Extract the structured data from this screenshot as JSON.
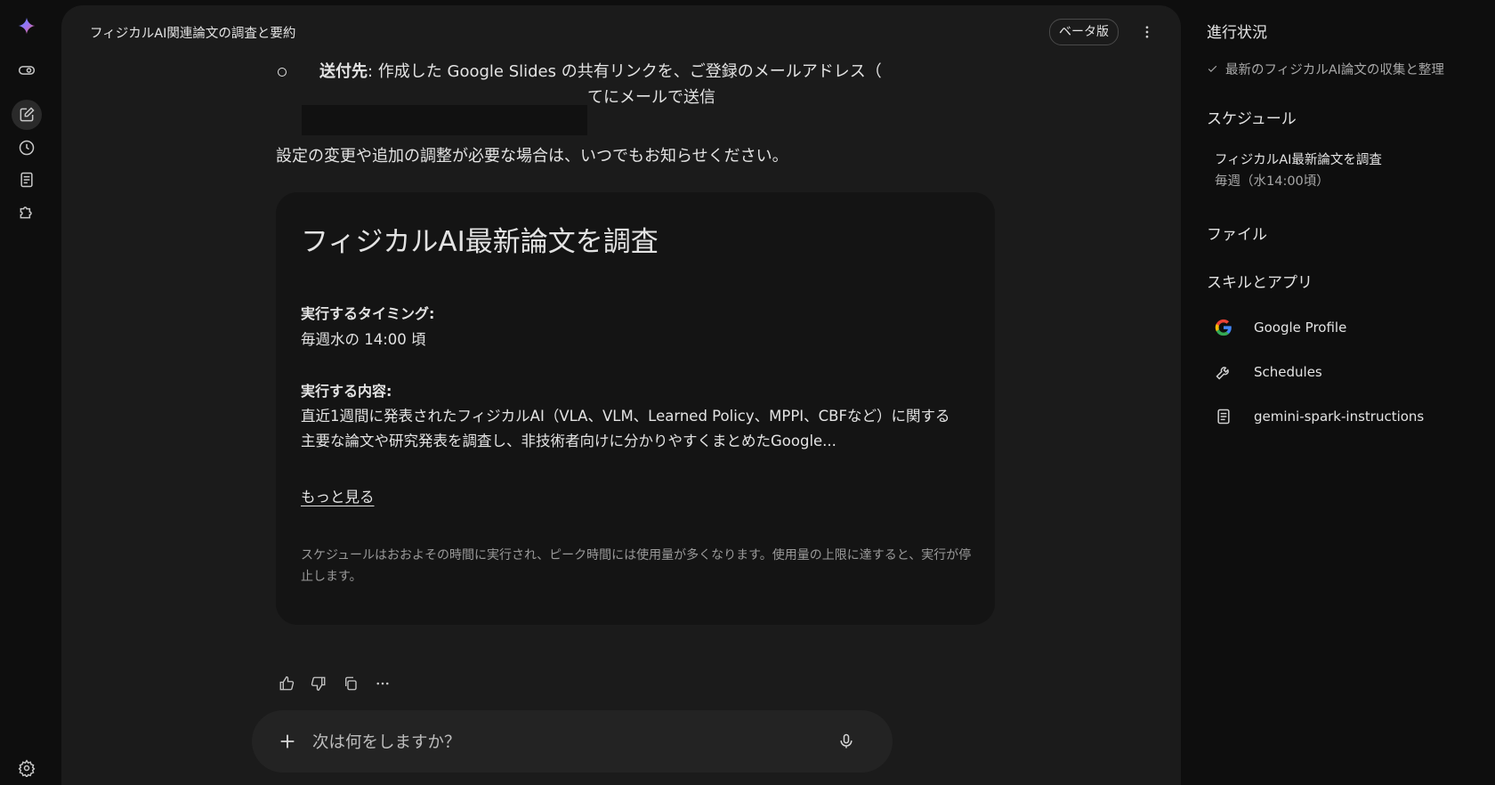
{
  "header": {
    "title": "フィジカルAI関連論文の調査と要約",
    "beta_label": "ベータ版"
  },
  "message": {
    "bullet_bold": "送付先",
    "bullet_text": ": 作成した Google Slides の共有リンクを、ご登録のメールアドレス（",
    "bullet_text_tail": "てにメールで送信",
    "paragraph": "設定の変更や追加の調整が必要な場合は、いつでもお知らせください。"
  },
  "card": {
    "title": "フィジカルAI最新論文を調査",
    "timing_label": "実行するタイミング:",
    "timing_value": "毎週水の 14:00 頃",
    "content_label": "実行する内容:",
    "content_line1": "直近1週間に発表されたフィジカルAI（VLA、VLM、Learned Policy、MPPI、CBFなど）に関する",
    "content_line2": "主要な論文や研究発表を調査し、非技術者向けに分かりやすくまとめたGoogle...",
    "more_link": "もっと見る",
    "note": "スケジュールはおおよその時間に実行され、ピーク時間には使用量が多くなります。使用量の上限に達すると、実行が停止します。"
  },
  "prompt": {
    "placeholder": "次は何をしますか？"
  },
  "side": {
    "progress_heading": "進行状況",
    "progress_item": "最新のフィジカルAI論文の収集と整理",
    "schedule_heading": "スケジュール",
    "schedule_title": "フィジカルAI最新論文を調査",
    "schedule_sub": "毎週（水14:00頃）",
    "files_heading": "ファイル",
    "apps_heading": "スキルとアプリ",
    "apps": [
      {
        "label": "Google Profile",
        "icon": "google-g-icon"
      },
      {
        "label": "Schedules",
        "icon": "wrench-icon"
      },
      {
        "label": "gemini-spark-instructions",
        "icon": "document-icon"
      }
    ]
  },
  "colors": {
    "background": "#0e0e0e",
    "panel": "#1b1b1b",
    "card": "#141414",
    "text": "#e3e3e3",
    "muted": "#9a9a9a"
  }
}
